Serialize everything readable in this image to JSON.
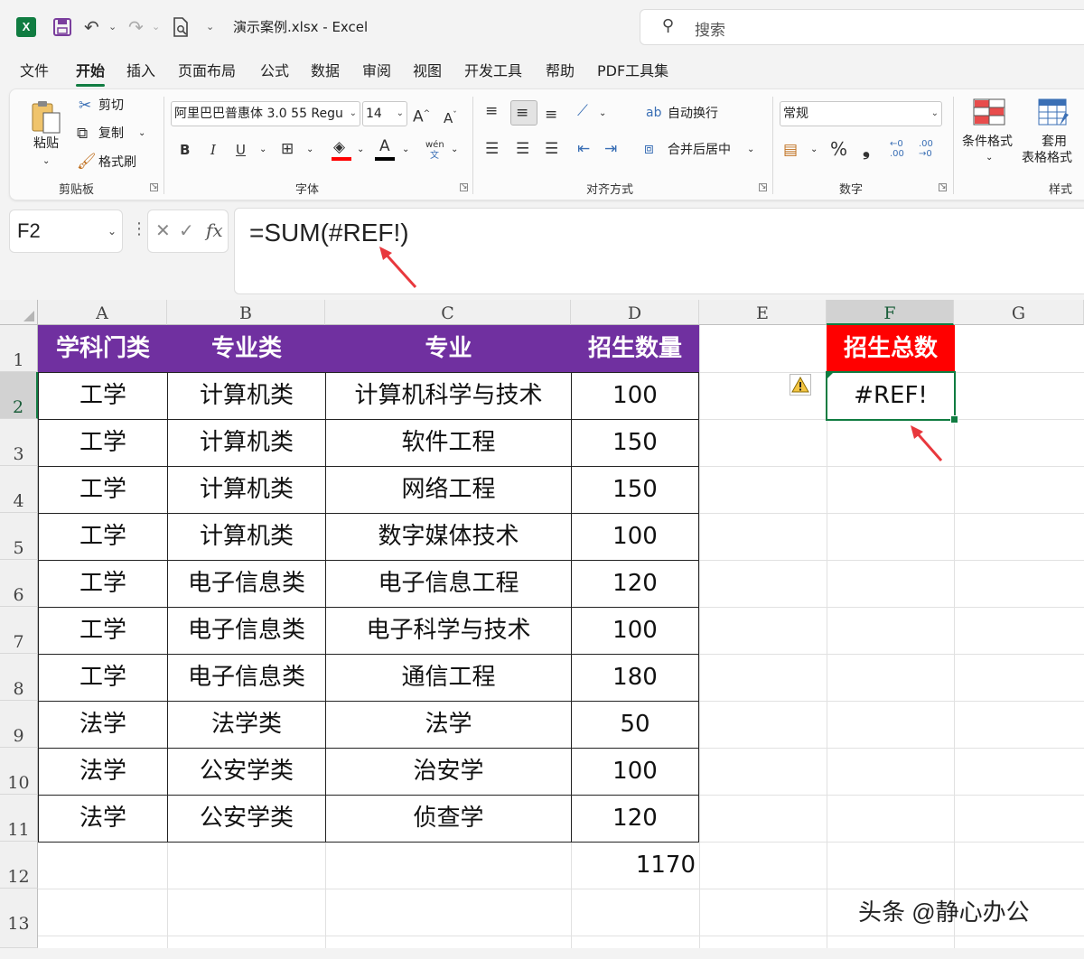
{
  "titlebar": {
    "app_badge": "X",
    "doc_title": "演示案例.xlsx  -  Excel",
    "search_placeholder": "搜索"
  },
  "tabs": [
    "文件",
    "开始",
    "插入",
    "页面布局",
    "公式",
    "数据",
    "审阅",
    "视图",
    "开发工具",
    "帮助",
    "PDF工具集"
  ],
  "active_tab": "开始",
  "ribbon": {
    "clipboard": {
      "paste": "粘贴",
      "cut": "剪切",
      "copy": "复制",
      "format_painter": "格式刷",
      "label": "剪贴板"
    },
    "font": {
      "font_name": "阿里巴巴普惠体 3.0 55 Regu",
      "font_size": "14",
      "label": "字体",
      "bold": "B",
      "italic": "I",
      "underline": "U",
      "phonetic": "wén"
    },
    "alignment": {
      "wrap": "自动换行",
      "merge": "合并后居中",
      "label": "对齐方式"
    },
    "number": {
      "format": "常规",
      "percent": "%",
      "comma": "❟",
      "label": "数字"
    },
    "styles": {
      "conditional": "条件格式",
      "table_line1": "套用",
      "table_line2": "表格格式",
      "label": "样式"
    }
  },
  "formula_bar": {
    "name_box": "F2",
    "fx": "fx",
    "formula": "=SUM(#REF!)"
  },
  "sheet": {
    "columns": [
      "A",
      "B",
      "C",
      "D",
      "E",
      "F",
      "G"
    ],
    "rows": [
      "1",
      "2",
      "3",
      "4",
      "5",
      "6",
      "7",
      "8",
      "9",
      "10",
      "11",
      "12",
      "13"
    ],
    "selected_column": "F",
    "selected_row": "2",
    "headers": [
      "学科门类",
      "专业类",
      "专业",
      "招生数量"
    ],
    "data": [
      [
        "工学",
        "计算机类",
        "计算机科学与技术",
        "100"
      ],
      [
        "工学",
        "计算机类",
        "软件工程",
        "150"
      ],
      [
        "工学",
        "计算机类",
        "网络工程",
        "150"
      ],
      [
        "工学",
        "计算机类",
        "数字媒体技术",
        "100"
      ],
      [
        "工学",
        "电子信息类",
        "电子信息工程",
        "120"
      ],
      [
        "工学",
        "电子信息类",
        "电子科学与技术",
        "100"
      ],
      [
        "工学",
        "电子信息类",
        "通信工程",
        "180"
      ],
      [
        "法学",
        "法学类",
        "法学",
        "50"
      ],
      [
        "法学",
        "公安学类",
        "治安学",
        "100"
      ],
      [
        "法学",
        "公安学类",
        "侦查学",
        "120"
      ]
    ],
    "total": "1170",
    "f1_header": "招生总数",
    "f2_value": "#REF!"
  },
  "watermark": "头条 @静心办公",
  "colors": {
    "header_purple": "#7030a0",
    "header_red": "#ff0000",
    "excel_green": "#107c41",
    "arrow_red": "#e8383d"
  }
}
